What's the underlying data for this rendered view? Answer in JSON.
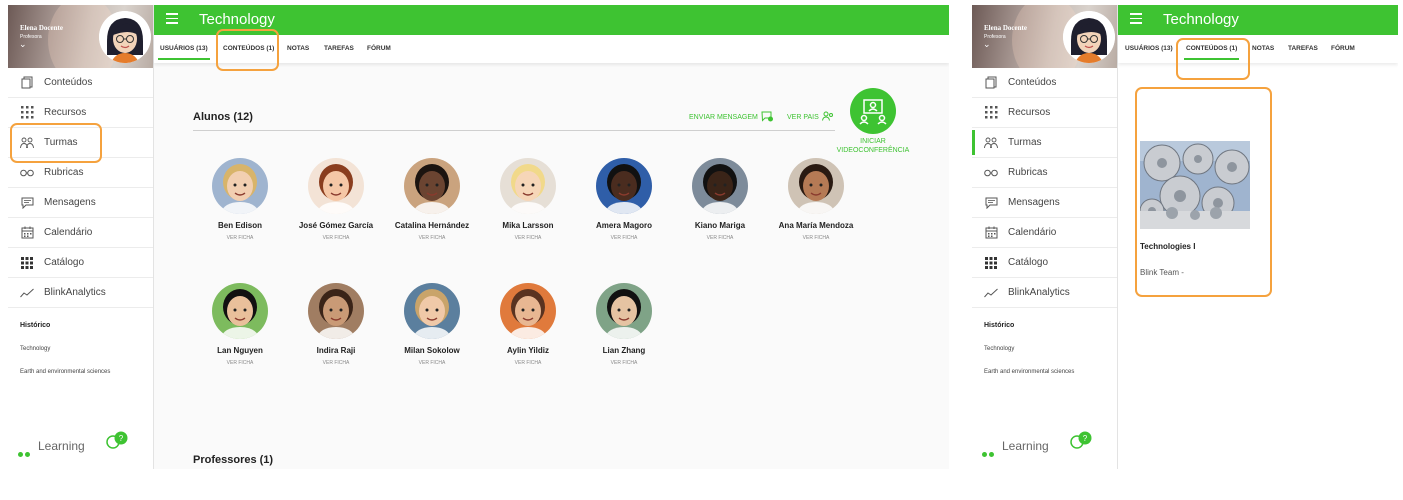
{
  "colors": {
    "brand_green": "#3ec332",
    "highlight_orange": "#f5a23e",
    "text_dark": "#222222"
  },
  "user": {
    "name": "Elena Docente",
    "role": "Profesora",
    "chevron": "⌄"
  },
  "app": {
    "title": "Technology",
    "menu_icon": "hamburger-menu-icon"
  },
  "sidebar": {
    "items": [
      {
        "label": "Conteúdos",
        "icon": "book-icon"
      },
      {
        "label": "Recursos",
        "icon": "grid-dots-icon"
      },
      {
        "label": "Turmas",
        "icon": "users-icon"
      },
      {
        "label": "Rubricas",
        "icon": "glasses-icon"
      },
      {
        "label": "Mensagens",
        "icon": "chat-icon"
      },
      {
        "label": "Calendário",
        "icon": "calendar-icon"
      },
      {
        "label": "Catálogo",
        "icon": "grid-icon"
      },
      {
        "label": "BlinkAnalytics",
        "icon": "analytics-icon"
      }
    ],
    "history_title": "Histórico",
    "history": [
      "Technology",
      "Earth and environmental sciences"
    ],
    "footer_label": "Learning",
    "help_badge": "?"
  },
  "tabs": [
    "USUÁRIOS (13)",
    "CONTEÚDOS (1)",
    "NOTAS",
    "TAREFAS",
    "FÓRUM"
  ],
  "left_panel": {
    "active_tab": "USUÁRIOS (13)",
    "active_nav": "Turmas",
    "highlighted_tab": "CONTEÚDOS (1)",
    "highlighted_nav": "Turmas"
  },
  "right_panel": {
    "active_tab": "CONTEÚDOS (1)",
    "active_nav": "Turmas",
    "highlighted_tab": "CONTEÚDOS (1)"
  },
  "students_section": {
    "title": "Alunos (12)",
    "send_message": "ENVIAR MENSAGEM",
    "see_parents": "VER PAIS",
    "video_label_line1": "INICIAR",
    "video_label_line2": "VIDEOCONFERÊNCIA",
    "view_label": "VER FICHA"
  },
  "students": [
    {
      "name": "Ben Edison",
      "view": "VER FICHA"
    },
    {
      "name": "José Gómez García",
      "view": "VER FICHA"
    },
    {
      "name": "Catalina Hernández",
      "view": "VER FICHA"
    },
    {
      "name": "Mika Larsson",
      "view": "VER FICHA"
    },
    {
      "name": "Amera Magoro",
      "view": "VER FICHA"
    },
    {
      "name": "Kiano Mariga",
      "view": "VER FICHA"
    },
    {
      "name": "Ana María Mendoza",
      "view": "VER FICHA"
    },
    {
      "name": "Lan Nguyen",
      "view": "VER FICHA"
    },
    {
      "name": "Indira Raji",
      "view": "VER FICHA"
    },
    {
      "name": "Milan Sokolow",
      "view": "VER FICHA"
    },
    {
      "name": "Aylin Yildiz",
      "view": "VER FICHA"
    },
    {
      "name": "Lian Zhang",
      "view": "VER FICHA"
    }
  ],
  "teachers_section": {
    "title": "Professores (1)"
  },
  "content_card": {
    "title": "Technologies I",
    "author": "Blink Team -",
    "image": "gears-image"
  }
}
